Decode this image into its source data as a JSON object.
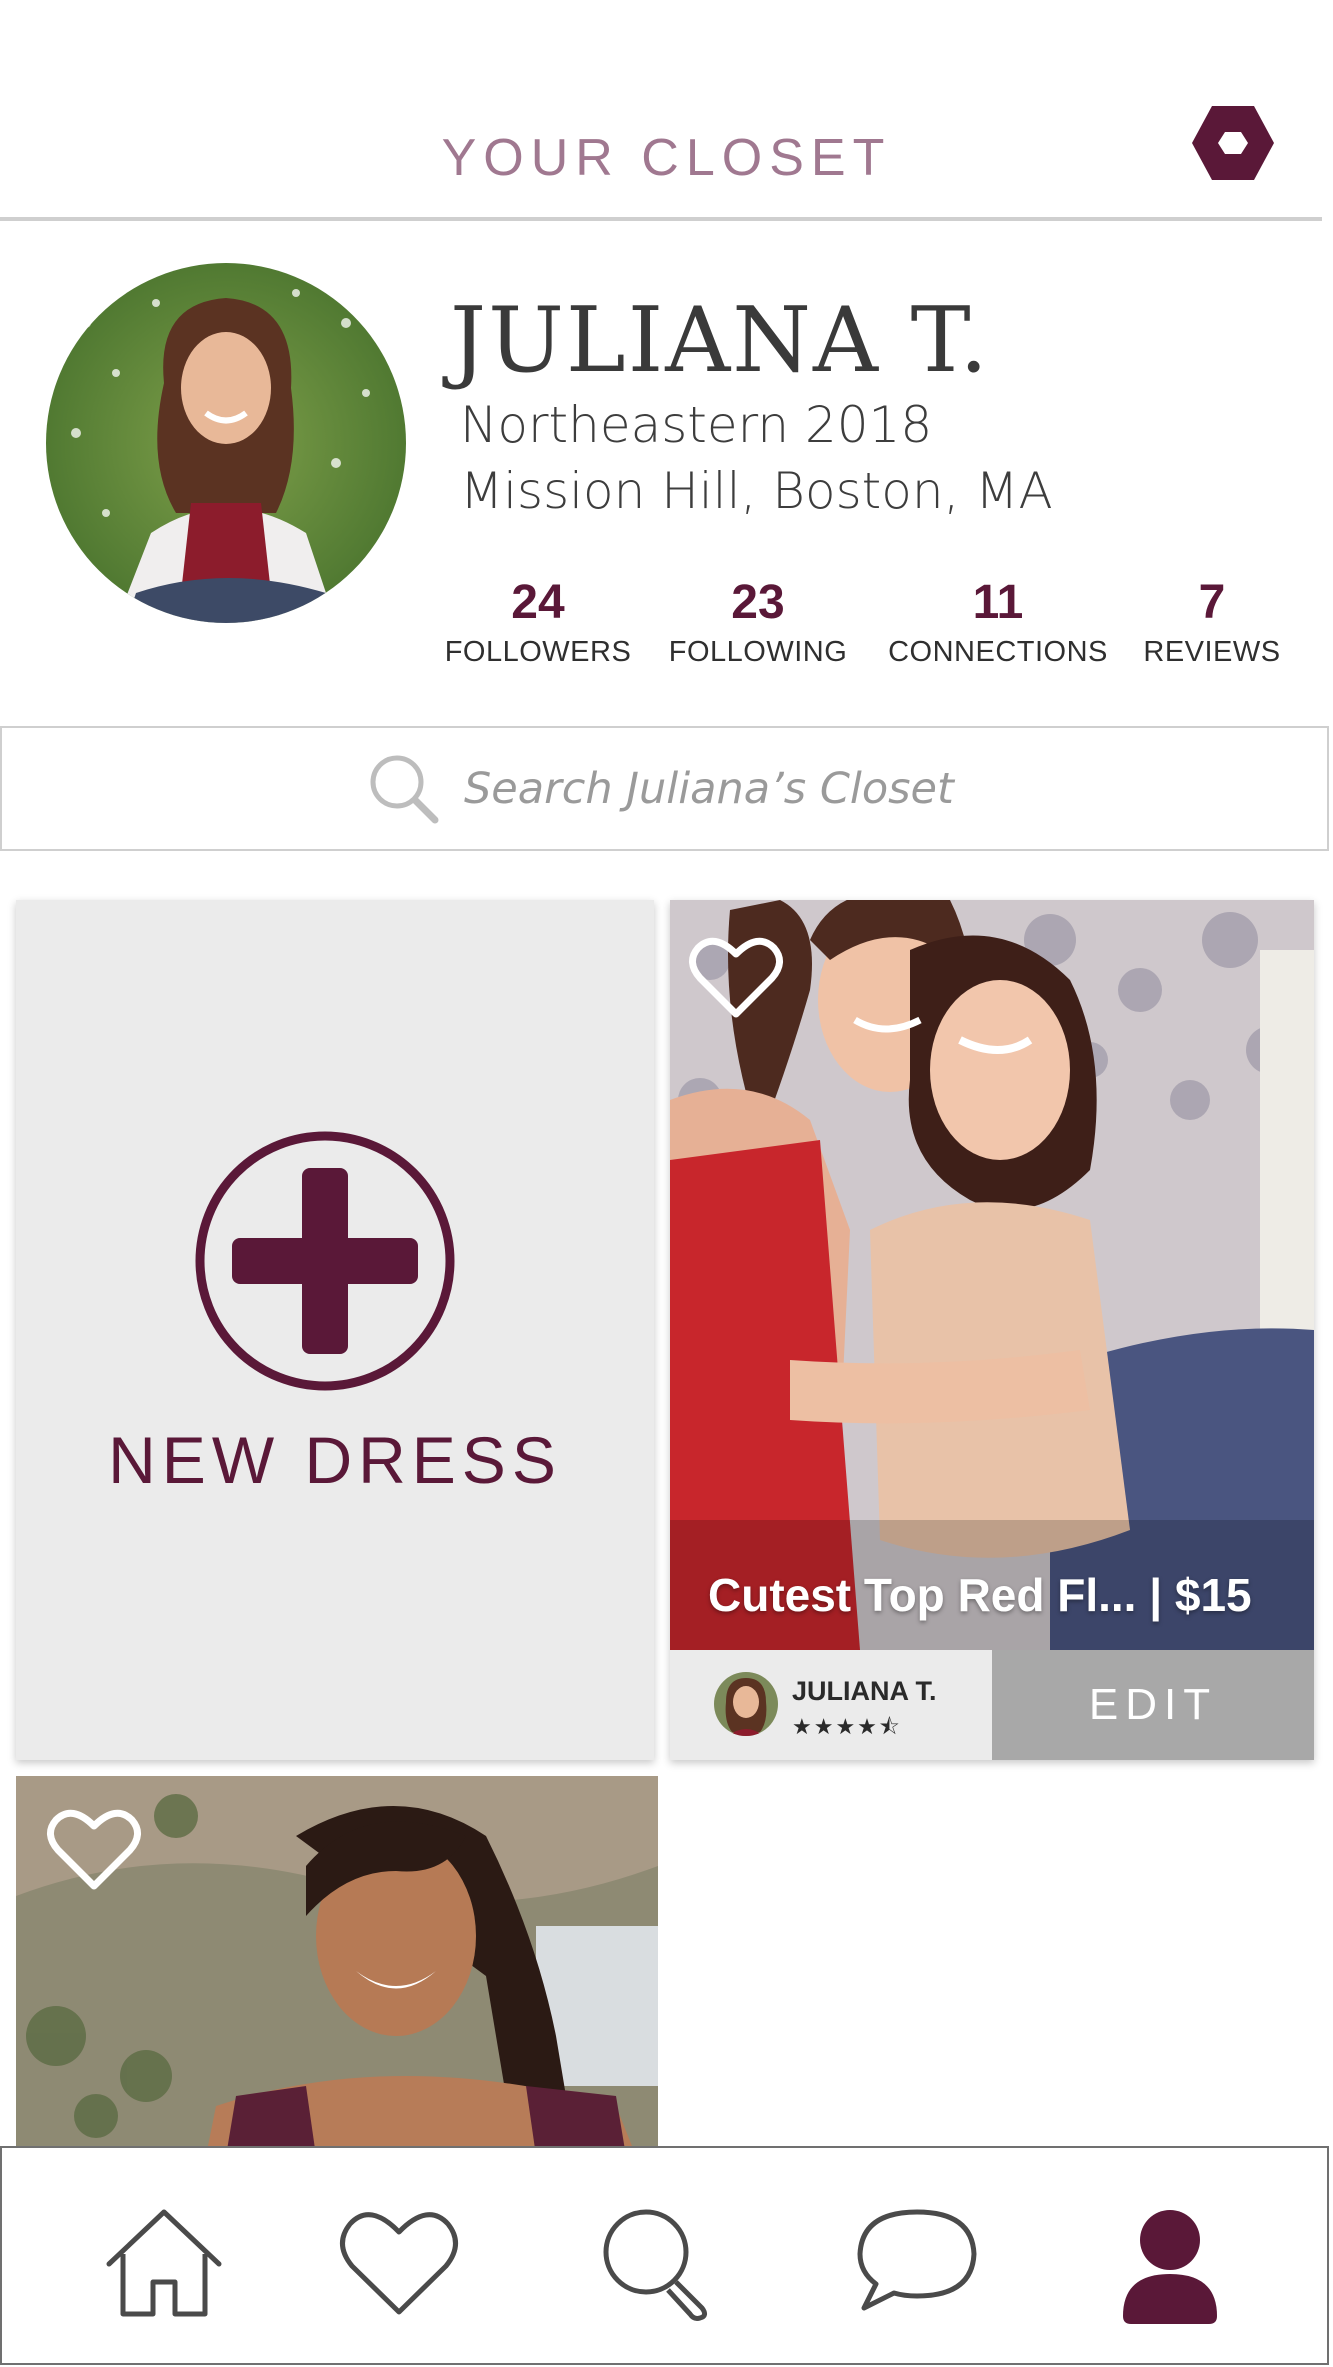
{
  "header": {
    "title": "YOUR CLOSET",
    "settings_icon": "hexagon-settings-icon"
  },
  "profile": {
    "name": "JULIANA T.",
    "school": "Northeastern 2018",
    "location": "Mission Hill, Boston, MA",
    "stats": [
      {
        "count": "24",
        "label": "FOLLOWERS"
      },
      {
        "count": "23",
        "label": "FOLLOWING"
      },
      {
        "count": "11",
        "label": "CONNECTIONS"
      },
      {
        "count": "7",
        "label": "REVIEWS"
      }
    ]
  },
  "search": {
    "placeholder": "Search Juliana’s Closet"
  },
  "new_dress": {
    "label": "NEW DRESS"
  },
  "listing": {
    "title": "Cutest Top Red Fl... | $15",
    "seller_name": "JULIANA T.",
    "rating": "★★★★⯪",
    "rating_value": 4.5,
    "edit_label": "EDIT"
  },
  "nav": {
    "items": [
      "home-icon",
      "heart-icon",
      "search-icon",
      "chat-bubble-icon",
      "profile-icon"
    ],
    "active": "profile-icon"
  },
  "colors": {
    "brand": "#5a1838",
    "header_title": "#a07890",
    "edit_button": "#a8a8a8",
    "card_bg": "#ebebeb"
  }
}
